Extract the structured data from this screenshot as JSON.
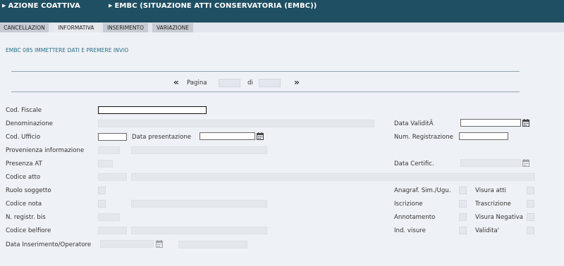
{
  "header": {
    "breadcrumb_1": "AZIONE COATTIVA",
    "breadcrumb_2": "EMBC (SITUAZIONE ATTI CONSERVATORIA (EMBC))"
  },
  "tabs": [
    "CANCELLAZION",
    "INFORMATIVA",
    "INSERIMENTO",
    "VARIAZIONE"
  ],
  "active_tab": "INFORMATIVA",
  "hint": "EMBC 085  IMMETTERE DATI E PREMERE INVIO",
  "pager": {
    "prev": "«",
    "label": "Pagina",
    "of": "di",
    "next": "»"
  },
  "fields": {
    "cod_fiscale": "Cod. Fiscale",
    "denominazione": "Denominazione",
    "data_validita": "Data ValiditÃ",
    "cod_ufficio": "Cod. Ufficio",
    "data_presentazione": "Data presentazione",
    "num_registrazione": "Num. Registrazione",
    "provenienza": "Provenienza informazione",
    "presenza_at": "Presenza AT",
    "data_certific": "Data Certific.",
    "codice_atto": "Codice atto",
    "ruolo_soggetto": "Ruolo soggetto",
    "anagraf": "Anagraf. Sim./Ugu.",
    "visura_atti": "Visura atti",
    "codice_nota": "Codice nota",
    "iscrizione": "Iscrizione",
    "trascrizione": "Trascrizione",
    "n_registr_bis": "N. registr. bis",
    "annotamento": "Annotamento",
    "visura_negativa": "Visura Negativa",
    "codice_belfiore": "Codice belfiore",
    "ind_visure": "Ind. visure",
    "validita": "Validita'",
    "data_inserimento": "Data Inserimento/Operatore"
  },
  "colors": {
    "header": "#1f4f62",
    "hint": "#2b6f85",
    "background": "#eef1f6"
  }
}
